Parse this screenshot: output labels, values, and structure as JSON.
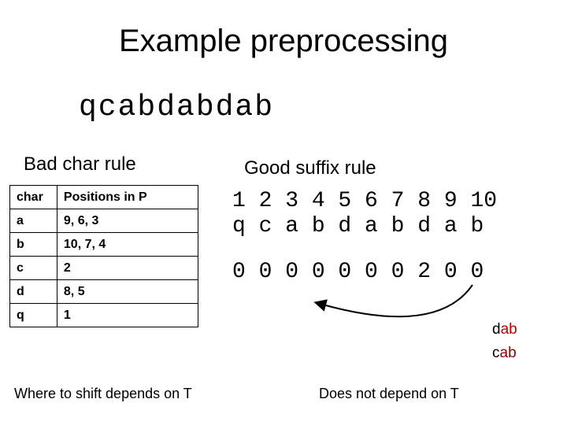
{
  "title": "Example preprocessing",
  "pattern": "qcabdabdab",
  "bad_char": {
    "header": "Bad char rule",
    "col1": "char",
    "col2": "Positions in P",
    "rows": [
      {
        "c": "a",
        "p": "9, 6, 3"
      },
      {
        "c": "b",
        "p": "10, 7, 4"
      },
      {
        "c": "c",
        "p": "2"
      },
      {
        "c": "d",
        "p": "8, 5"
      },
      {
        "c": "q",
        "p": "1"
      }
    ]
  },
  "good_suffix": {
    "header": "Good suffix rule",
    "positions": "1 2 3 4 5 6 7 8 9 10",
    "pattern": "q c a b d a b d a b",
    "values": "0 0 0 0 0 0 0 2 0 0",
    "label1_pre": "d",
    "label1_suf": "ab",
    "label2_pre": "c",
    "label2_suf": "ab"
  },
  "captions": {
    "left": "Where to shift depends on T",
    "right": "Does not depend on T"
  }
}
